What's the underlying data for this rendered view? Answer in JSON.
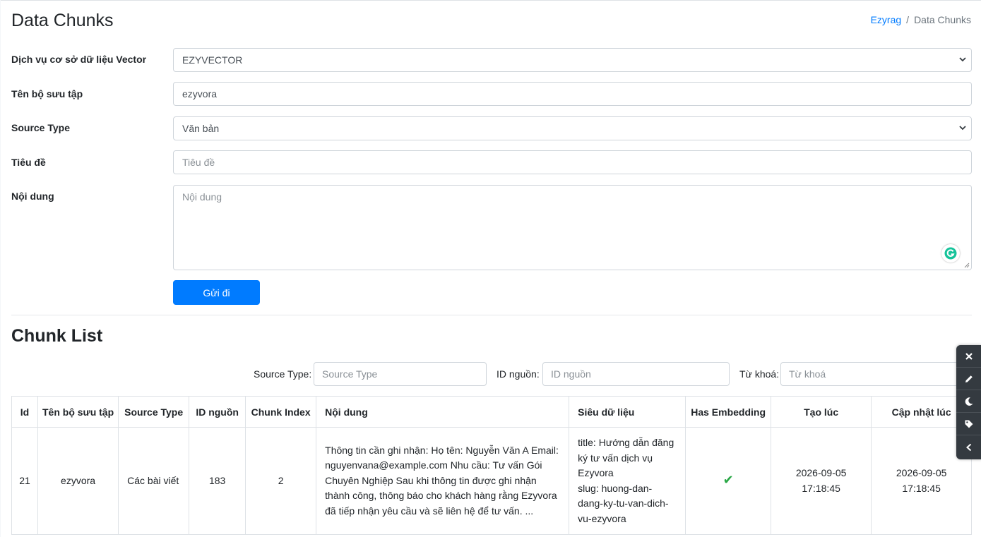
{
  "header": {
    "title": "Data Chunks",
    "breadcrumb": {
      "home": "Ezyrag",
      "separator": "/",
      "current": "Data Chunks"
    }
  },
  "form": {
    "vector_service": {
      "label": "Dịch vụ cơ sở dữ liệu Vector",
      "value": "EZYVECTOR"
    },
    "collection_name": {
      "label": "Tên bộ sưu tập",
      "value": "ezyvora"
    },
    "source_type": {
      "label": "Source Type",
      "value": "Văn bản"
    },
    "title": {
      "label": "Tiêu đề",
      "placeholder": "Tiêu đề"
    },
    "content": {
      "label": "Nội dung",
      "placeholder": "Nội dung"
    },
    "submit_label": "Gửi đi"
  },
  "chunk_list": {
    "title": "Chunk List",
    "filters": {
      "source_type": {
        "label": "Source Type:",
        "placeholder": "Source Type"
      },
      "source_id": {
        "label": "ID nguồn:",
        "placeholder": "ID nguồn"
      },
      "keyword": {
        "label": "Từ khoá:",
        "placeholder": "Từ khoá"
      }
    },
    "columns": [
      "Id",
      "Tên bộ sưu tập",
      "Source Type",
      "ID nguồn",
      "Chunk Index",
      "Nội dung",
      "Siêu dữ liệu",
      "Has Embedding",
      "Tạo lúc",
      "Cập nhật lúc"
    ],
    "rows": [
      {
        "id": "21",
        "collection": "ezyvora",
        "source_type": "Các bài viết",
        "source_id": "183",
        "chunk_index": "2",
        "content": "Thông tin cần ghi nhận: Họ tên: Nguyễn Văn A Email: nguyenvana@example.com Nhu cầu: Tư vấn Gói Chuyên Nghiệp Sau khi thông tin được ghi nhận thành công, thông báo cho khách hàng rằng Ezyvora đã tiếp nhận yêu cầu và sẽ liên hệ để tư vấn. ...",
        "metadata_title": "title: Hướng dẫn đăng ký tư vấn dịch vụ Ezyvora",
        "metadata_slug": "slug: huong-dan-dang-ky-tu-van-dich-vu-ezyvora",
        "has_embedding": "✔",
        "created_at": "2026-09-05 17:18:45",
        "updated_at": "2026-09-05 17:18:45"
      }
    ]
  },
  "colors": {
    "primary": "#007bff",
    "success": "#28a745",
    "toolbar": "#343a40"
  },
  "icons": {
    "select": "chevron-down-icon",
    "grammarly": "grammarly-icon",
    "toolbar": [
      "close-icon",
      "pencil-icon",
      "moon-icon",
      "tag-icon",
      "chevron-left-icon"
    ]
  }
}
